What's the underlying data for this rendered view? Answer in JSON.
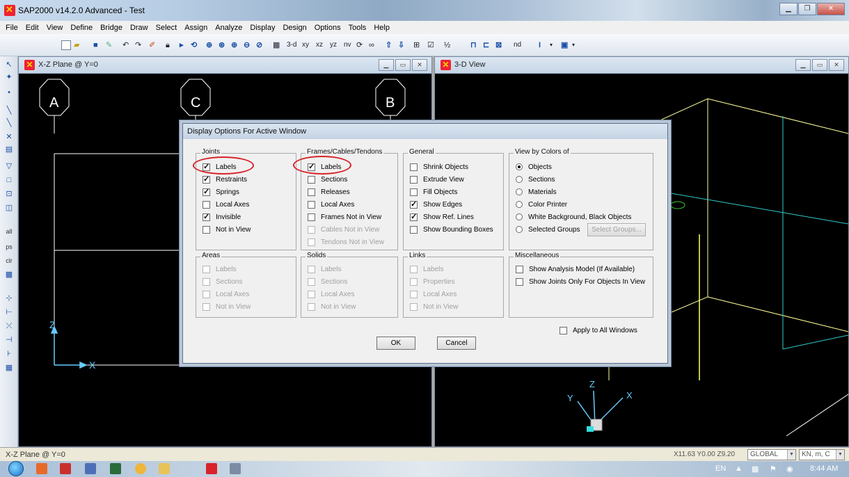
{
  "app": {
    "title": "SAP2000 v14.2.0 Advanced  - Test"
  },
  "menu": [
    "File",
    "Edit",
    "View",
    "Define",
    "Bridge",
    "Draw",
    "Select",
    "Assign",
    "Analyze",
    "Display",
    "Design",
    "Options",
    "Tools",
    "Help"
  ],
  "toolbar": {
    "view_3d": "3-d",
    "view_xy": "xy",
    "view_xz": "xz",
    "view_yz": "yz",
    "view_nv": "nv",
    "nd_label": "nd"
  },
  "left_toolbar": {
    "all": "all",
    "ps": "ps",
    "clr": "clr"
  },
  "windows": {
    "left": {
      "title": "X-Z Plane @ Y=0",
      "grid_labels": [
        "A",
        "C",
        "B"
      ],
      "axis_z": "Z",
      "axis_x": "X"
    },
    "right": {
      "title": "3-D View",
      "axis_x": "X",
      "axis_y": "Y",
      "axis_z": "Z"
    }
  },
  "dialog": {
    "title": "Display Options For Active Window",
    "joints": {
      "title": "Joints",
      "items": [
        {
          "label": "Labels",
          "checked": true
        },
        {
          "label": "Restraints",
          "checked": true
        },
        {
          "label": "Springs",
          "checked": true
        },
        {
          "label": "Local Axes",
          "checked": false
        },
        {
          "label": "Invisible",
          "checked": true
        },
        {
          "label": "Not in View",
          "checked": false
        }
      ]
    },
    "frames": {
      "title": "Frames/Cables/Tendons",
      "items": [
        {
          "label": "Labels",
          "checked": true
        },
        {
          "label": "Sections",
          "checked": false
        },
        {
          "label": "Releases",
          "checked": false
        },
        {
          "label": "Local Axes",
          "checked": false
        },
        {
          "label": "Frames Not in View",
          "checked": false
        },
        {
          "label": "Cables Not in View",
          "checked": false
        },
        {
          "label": "Tendons Not in View",
          "checked": false
        }
      ]
    },
    "general": {
      "title": "General",
      "items": [
        {
          "label": "Shrink Objects",
          "checked": false
        },
        {
          "label": "Extrude View",
          "checked": false
        },
        {
          "label": "Fill Objects",
          "checked": false
        },
        {
          "label": "Show Edges",
          "checked": true
        },
        {
          "label": "Show Ref. Lines",
          "checked": true
        },
        {
          "label": "Show Bounding Boxes",
          "checked": false
        }
      ]
    },
    "colors": {
      "title": "View by Colors of",
      "items": [
        {
          "label": "Objects",
          "selected": true
        },
        {
          "label": "Sections",
          "selected": false
        },
        {
          "label": "Materials",
          "selected": false
        },
        {
          "label": "Color Printer",
          "selected": false
        },
        {
          "label": "White Background, Black Objects",
          "selected": false
        },
        {
          "label": "Selected Groups",
          "selected": false
        }
      ],
      "select_groups_button": "Select Groups..."
    },
    "areas": {
      "title": "Areas",
      "items": [
        "Labels",
        "Sections",
        "Local Axes",
        "Not in View"
      ]
    },
    "solids": {
      "title": "Solids",
      "items": [
        "Labels",
        "Sections",
        "Local Axes",
        "Not in View"
      ]
    },
    "links": {
      "title": "Links",
      "items": [
        "Labels",
        "Properties",
        "Local Axes",
        "Not in View"
      ]
    },
    "misc": {
      "title": "Miscellaneous",
      "items": [
        {
          "label": "Show Analysis Model  (If Available)",
          "checked": false
        },
        {
          "label": "Show Joints Only For Objects In View",
          "checked": false
        }
      ]
    },
    "apply_all": "Apply to All Windows",
    "ok": "OK",
    "cancel": "Cancel"
  },
  "status": {
    "left": "X-Z Plane @ Y=0",
    "coords": "X11.63  Y0.00  Z9.20",
    "coord_system": "GLOBAL",
    "units": "KN, m, C"
  },
  "taskbar": {
    "lang": "EN",
    "time": "8:44 AM"
  },
  "colors": {
    "highlight_circle": "#d9232b",
    "frame_line": "#ffff99",
    "frame_cyan": "#33cccc"
  }
}
